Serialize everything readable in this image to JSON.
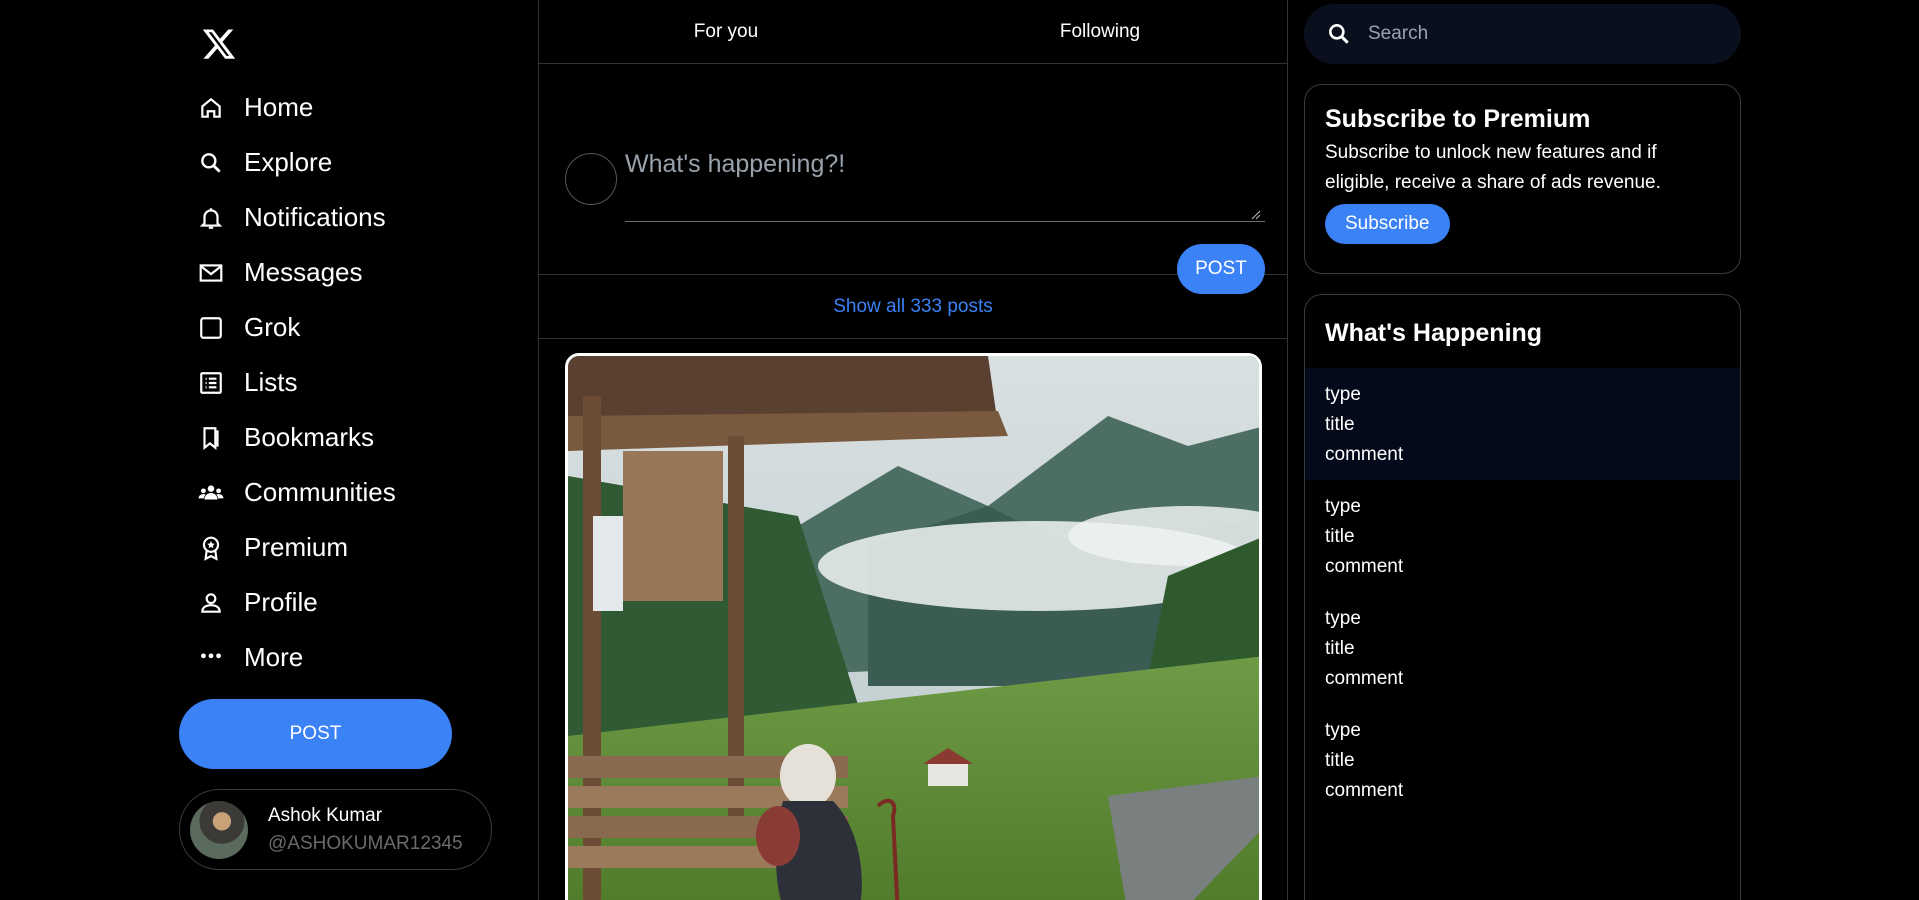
{
  "colors": {
    "accent": "#3b82f6",
    "background": "#000000",
    "border": "#2f3336"
  },
  "sidebar": {
    "logo_icon": "x-logo-icon",
    "items": [
      {
        "label": "Home",
        "icon": "home-icon"
      },
      {
        "label": "Explore",
        "icon": "search-icon"
      },
      {
        "label": "Notifications",
        "icon": "bell-icon"
      },
      {
        "label": "Messages",
        "icon": "mail-icon"
      },
      {
        "label": "Grok",
        "icon": "square-icon"
      },
      {
        "label": "Lists",
        "icon": "list-icon"
      },
      {
        "label": "Bookmarks",
        "icon": "bookmark-icon"
      },
      {
        "label": "Communities",
        "icon": "people-icon"
      },
      {
        "label": "Premium",
        "icon": "badge-icon"
      },
      {
        "label": "Profile",
        "icon": "person-icon"
      },
      {
        "label": "More",
        "icon": "more-icon"
      }
    ],
    "post_label": "POST",
    "profile": {
      "name": "Ashok Kumar",
      "handle": "@ASHOKUMAR12345"
    }
  },
  "center": {
    "tabs": [
      {
        "label": "For you"
      },
      {
        "label": "Following"
      }
    ],
    "composer": {
      "placeholder": "What's happening?!",
      "post_label": "POST"
    },
    "show_all": "Show all 333 posts",
    "post_image_alt": "elderly woman on bench"
  },
  "right": {
    "search_placeholder": "Search",
    "premium": {
      "title": "Subscribe to Premium",
      "text": "Subscribe to unlock new features and if eligible, receive a share of ads revenue.",
      "button": "Subscribe"
    },
    "happening": {
      "title": "What's Happening",
      "trends": [
        {
          "type": "type",
          "title": "title",
          "comment": "comment"
        },
        {
          "type": "type",
          "title": "title",
          "comment": "comment"
        },
        {
          "type": "type",
          "title": "title",
          "comment": "comment"
        },
        {
          "type": "type",
          "title": "title",
          "comment": "comment"
        }
      ]
    }
  }
}
